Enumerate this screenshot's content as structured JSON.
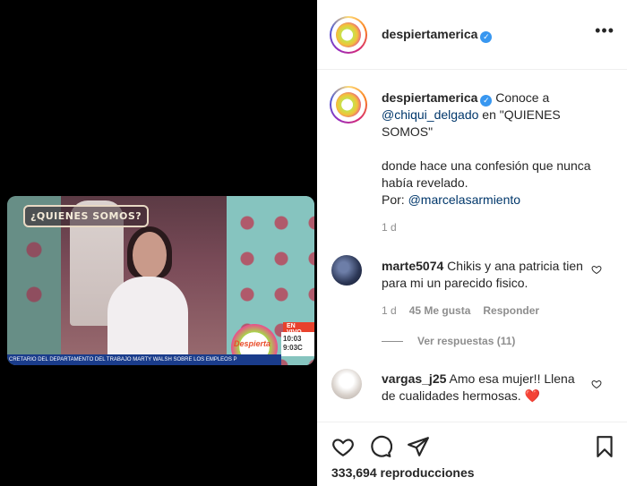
{
  "video": {
    "show_logo": "¿QUIENES SOMOS?",
    "live_badge": "EN VIVO",
    "clock_time": "10:03",
    "clock_time2": "9:03C",
    "brand": "Despierta",
    "ticker": "CRETARIO DEL DEPARTAMENTO DEL TRABAJO MARTY WALSH SOBRE LOS EMPLEOS P"
  },
  "post": {
    "account": "despiertamerica",
    "more_icon": "more-options-icon"
  },
  "caption": {
    "username": "despiertamerica",
    "text_1": "Conoce a",
    "mention_1": "@chiqui_delgado",
    "text_2": " en \"QUIENES SOMOS\"",
    "text_3": "donde hace una confesión que nunca había revelado.",
    "text_4": "Por:",
    "mention_2": "@marcelasarmiento",
    "time": "1 d"
  },
  "comments": [
    {
      "username": "marte5074",
      "text": "Chikis y ana patricia tien para mi un parecido fisico.",
      "time": "1 d",
      "likes": "45 Me gusta",
      "reply": "Responder",
      "view_replies": "Ver respuestas (11)"
    },
    {
      "username": "vargas_j25",
      "text": "Amo esa mujer!! Llena de cualidades hermosas.",
      "emoji": "❤️"
    }
  ],
  "footer": {
    "views": "333,694 reproducciones"
  },
  "colors": {
    "verified": "#3897f0",
    "link": "#00376b",
    "muted": "#8e8e8e",
    "heart": "#ed4956"
  }
}
